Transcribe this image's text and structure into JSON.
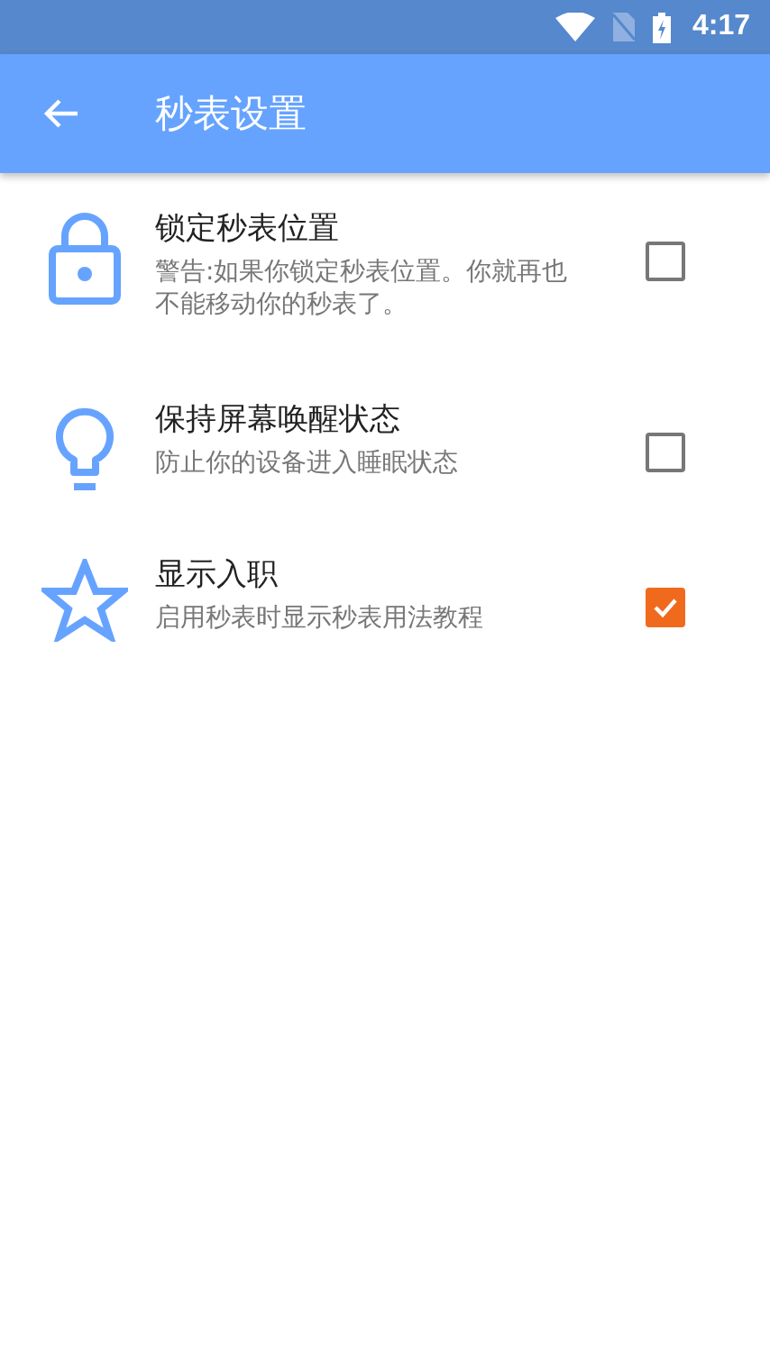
{
  "status_bar": {
    "time": "4:17"
  },
  "app_bar": {
    "title": "秒表设置"
  },
  "settings": [
    {
      "title": "锁定秒表位置",
      "description": "警告:如果你锁定秒表位置。你就再也不能移动你的秒表了。",
      "checked": false
    },
    {
      "title": "保持屏幕唤醒状态",
      "description": "防止你的设备进入睡眠状态",
      "checked": false
    },
    {
      "title": "显示入职",
      "description": "启用秒表时显示秒表用法教程",
      "checked": true
    }
  ]
}
